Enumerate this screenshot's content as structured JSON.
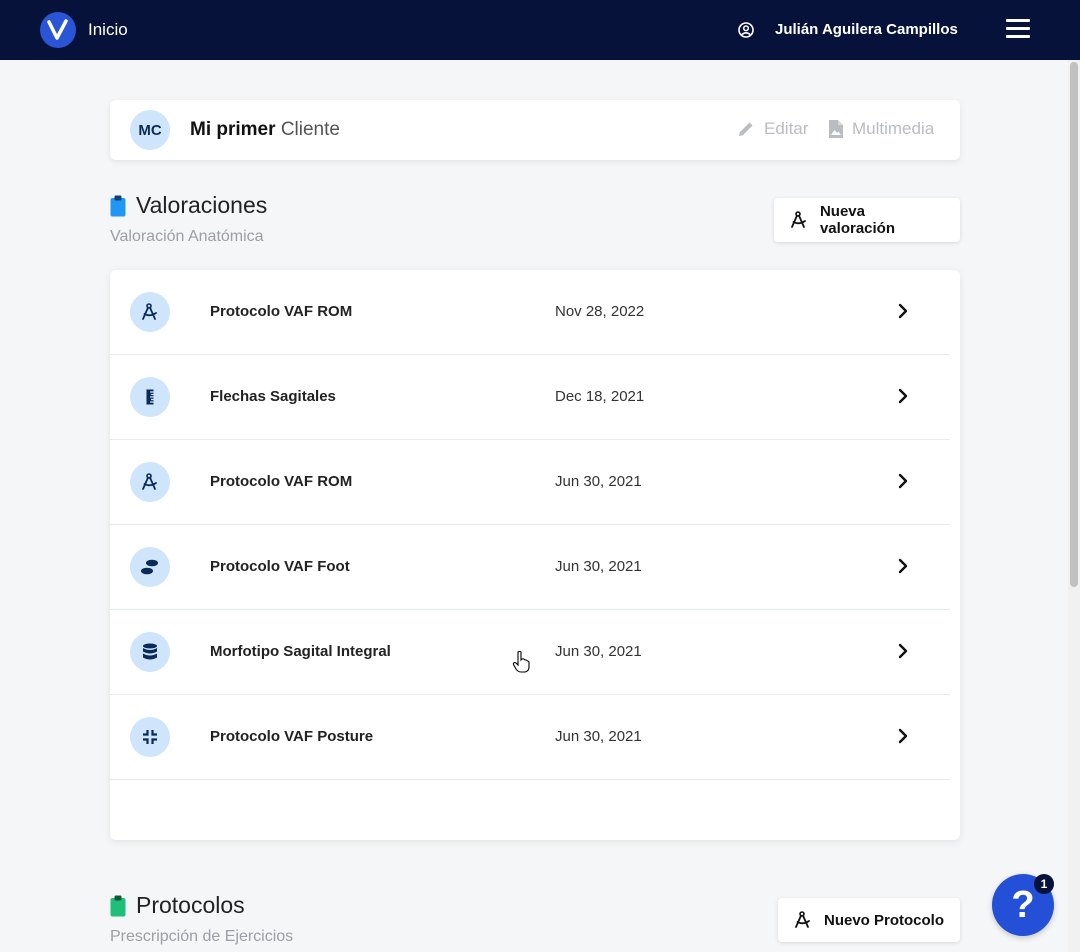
{
  "topbar": {
    "home_label": "Inicio",
    "user_name": "Julián Aguilera Campillos"
  },
  "client": {
    "initials": "MC",
    "name_bold": "Mi primer",
    "name_light": "Cliente",
    "edit_label": "Editar",
    "media_label": "Multimedia"
  },
  "valoraciones": {
    "title": "Valoraciones",
    "subtitle": "Valoración Anatómica",
    "new_button": "Nueva valoración",
    "rows": [
      {
        "name": "Protocolo VAF ROM",
        "date": "Nov 28, 2022",
        "icon": "compass-icon"
      },
      {
        "name": "Flechas Sagitales",
        "date": "Dec 18, 2021",
        "icon": "ruler-icon"
      },
      {
        "name": "Protocolo VAF ROM",
        "date": "Jun 30, 2021",
        "icon": "compass-icon"
      },
      {
        "name": "Protocolo VAF Foot",
        "date": "Jun 30, 2021",
        "icon": "footprints-icon"
      },
      {
        "name": "Morfotipo Sagital Integral",
        "date": "Jun 30, 2021",
        "icon": "database-icon"
      },
      {
        "name": "Protocolo VAF Posture",
        "date": "Jun 30, 2021",
        "icon": "compress-icon"
      }
    ]
  },
  "protocolos": {
    "title": "Protocolos",
    "subtitle": "Prescripción de Ejercicios",
    "new_button": "Nuevo Protocolo"
  },
  "help": {
    "symbol": "?",
    "badge_count": "1"
  },
  "colors": {
    "topbar": "#07123a",
    "accent": "#2450d8",
    "icon_bg": "#cfe5fb",
    "valoraciones_icon": "#2196f3",
    "protocolos_icon": "#1fbf7a"
  }
}
